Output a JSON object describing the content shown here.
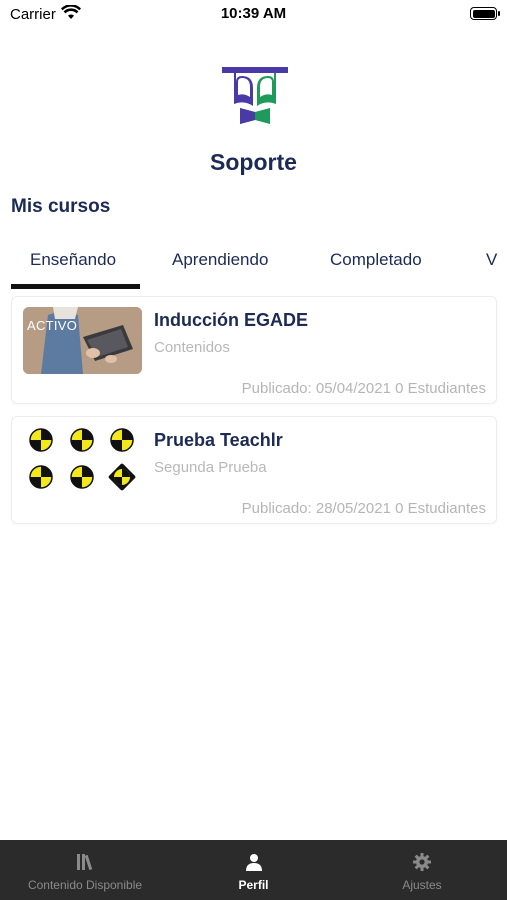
{
  "status_bar": {
    "carrier": "Carrier",
    "time": "10:39 AM"
  },
  "header": {
    "title": "Soporte",
    "logo_icon": "teachlr-book-logo-icon"
  },
  "section": {
    "title": "Mis cursos"
  },
  "tabs": [
    {
      "label": "Enseñando",
      "active": true
    },
    {
      "label": "Aprendiendo",
      "active": false
    },
    {
      "label": "Completado",
      "active": false
    },
    {
      "label": "V",
      "active": false
    }
  ],
  "courses": [
    {
      "badge": "ACTIVO",
      "title": "Inducción EGADE",
      "subtitle": "Contenidos",
      "meta": "Publicado: 05/04/2021 0 Estudiantes",
      "thumbnail": "laptop-photo"
    },
    {
      "badge": "",
      "title": "Prueba Teachlr",
      "subtitle": "Segunda Prueba",
      "meta": "Publicado: 28/05/2021 0 Estudiantes",
      "thumbnail": "crash-test-markers-image"
    }
  ],
  "bottom_nav": [
    {
      "label": "Contenido Disponible",
      "icon": "library-books-icon",
      "active": false
    },
    {
      "label": "Perfil",
      "icon": "person-icon",
      "active": true
    },
    {
      "label": "Ajustes",
      "icon": "gear-icon",
      "active": false
    }
  ],
  "colors": {
    "primary_navy": "#1c2a55",
    "nav_background": "#2b2b2b",
    "logo_purple": "#4a3aa8",
    "logo_green": "#1f9a5a"
  }
}
